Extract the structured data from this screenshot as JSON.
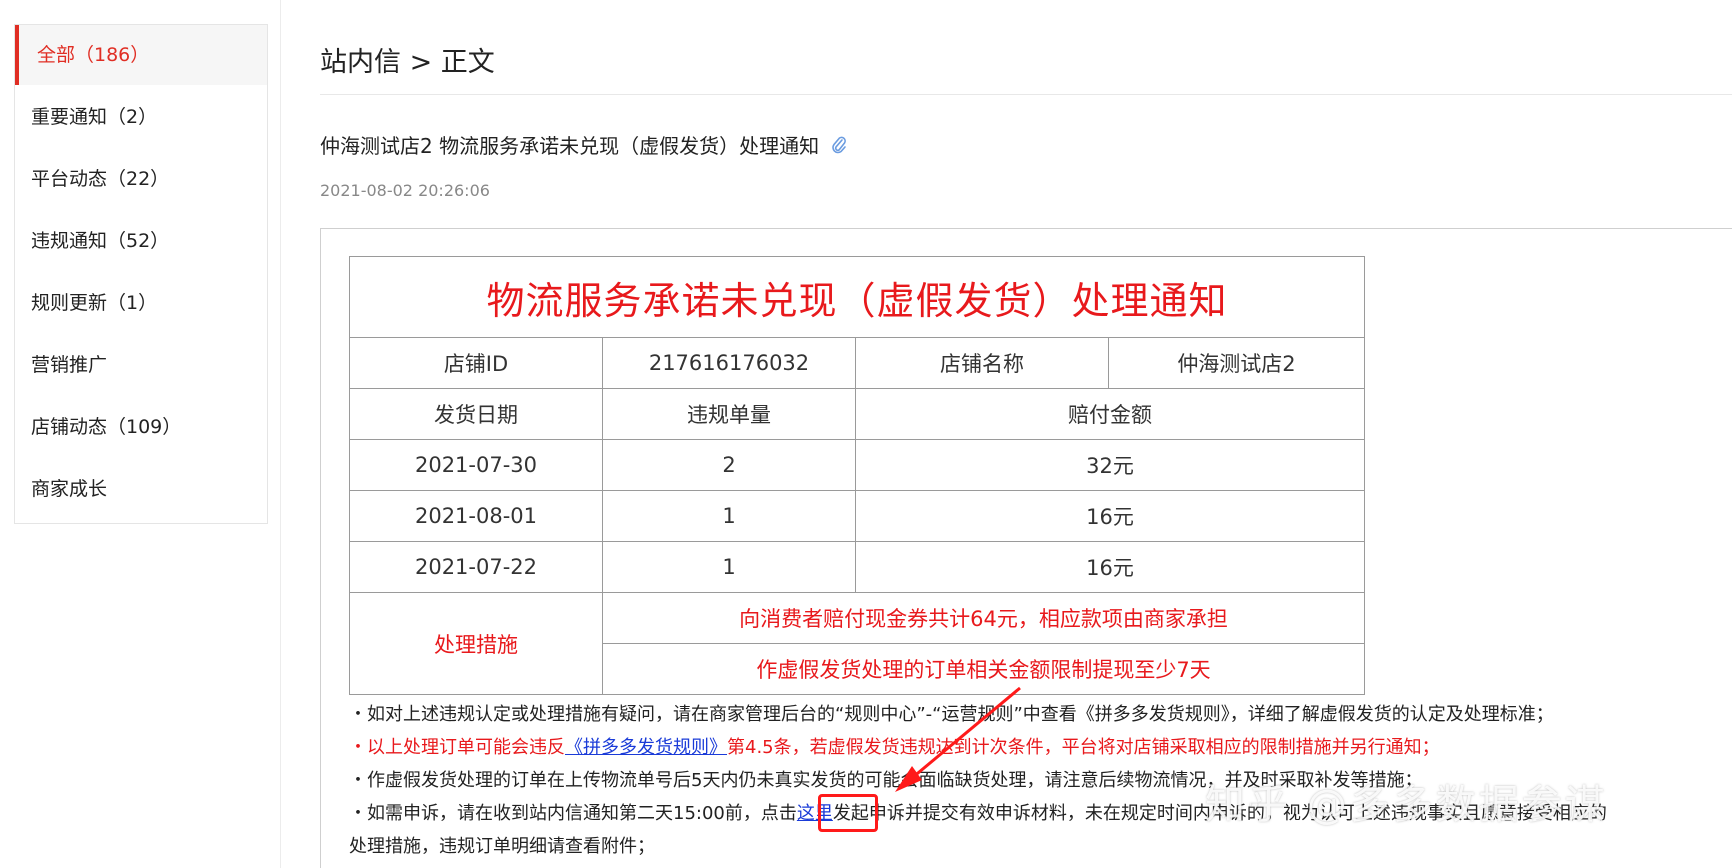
{
  "sidebar": {
    "items": [
      {
        "label": "全部（186）"
      },
      {
        "label": "重要通知（2）"
      },
      {
        "label": "平台动态（22）"
      },
      {
        "label": "违规通知（52）"
      },
      {
        "label": "规则更新（1）"
      },
      {
        "label": "营销推广"
      },
      {
        "label": "店铺动态（109）"
      },
      {
        "label": "商家成长"
      }
    ]
  },
  "header": {
    "breadcrumb": "站内信 > 正文",
    "message_title": "仲海测试店2 物流服务承诺未兑现（虚假发货）处理通知",
    "timestamp": "2021-08-02 20:26:06"
  },
  "notice": {
    "title": "物流服务承诺未兑现（虚假发货）处理通知",
    "shop_id_label": "店铺ID",
    "shop_id": "217616176032",
    "shop_name_label": "店铺名称",
    "shop_name": "仲海测试店2",
    "col_date": "发货日期",
    "col_count": "违规单量",
    "col_amount": "赔付金额",
    "rows": [
      {
        "date": "2021-07-30",
        "count": "2",
        "amount": "32元"
      },
      {
        "date": "2021-08-01",
        "count": "1",
        "amount": "16元"
      },
      {
        "date": "2021-07-22",
        "count": "1",
        "amount": "16元"
      }
    ],
    "measures_label": "处理措施",
    "measure_1": "向消费者赔付现金券共计64元，相应款项由商家承担",
    "measure_2": "作虚假发货处理的订单相关金额限制提现至少7天"
  },
  "notes": {
    "n1": "・如对上述违规认定或处理措施有疑问，请在商家管理后台的“规则中心”-“运营规则”中查看《拼多多发货规则》，详细了解虚假发货的认定及处理标准；",
    "n2_prefix": "・以上处理订单可能会违反",
    "n2_link": "《拼多多发货规则》",
    "n2_suffix": "第4.5条，若虚假发货违规达到计次条件，平台将对店铺采取相应的限制措施并另行通知；",
    "n3": "・作虚假发货处理的订单在上传物流单号后5天内仍未真实发货的可能会面临缺货处理，请注意后续物流情况，并及时采取补发等措施；",
    "n4_prefix": "・如需申诉，请在收到站内信通知第二天15:00前，点击",
    "n4_link": "这里",
    "n4_suffix": "发起申诉并提交有效申诉材料，未在规定时间内申诉的，视为认可上述违规事实且愿意接受相应的",
    "n5": "处理措施，违规订单明细请查看附件；"
  },
  "watermark": "知乎 @多多数据参谋",
  "colors": {
    "accent": "#e02e24",
    "notice_red": "#e8191c",
    "link": "#1a3bd8"
  }
}
